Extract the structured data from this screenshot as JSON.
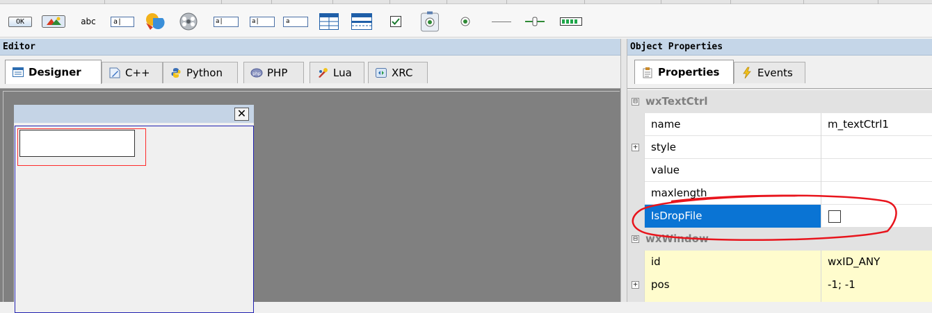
{
  "toolbar": {
    "items": [
      {
        "icon": "button-icon",
        "text": "OK"
      },
      {
        "icon": "bitmap-button-icon"
      },
      {
        "icon": "static-text-icon",
        "text": "abc"
      },
      {
        "icon": "text-ctrl-icon",
        "text": "a|"
      },
      {
        "icon": "combo-box-icon"
      },
      {
        "icon": "choice-icon"
      },
      {
        "icon": "list-box-icon",
        "text": "a|"
      },
      {
        "icon": "spin-ctrl-icon",
        "text": "a|"
      },
      {
        "icon": "dropdown-icon",
        "text": "a"
      },
      {
        "icon": "list-ctrl-icon"
      },
      {
        "icon": "grid-icon"
      },
      {
        "icon": "checkbox-icon"
      },
      {
        "icon": "radio-box-icon"
      },
      {
        "icon": "radio-button-icon"
      },
      {
        "icon": "static-line-icon"
      },
      {
        "icon": "slider-icon"
      },
      {
        "icon": "gauge-icon"
      }
    ]
  },
  "editor": {
    "title": "Editor",
    "tabs": [
      {
        "label": "Designer",
        "icon": "designer-icon",
        "active": true
      },
      {
        "label": "C++",
        "icon": "cpp-icon"
      },
      {
        "label": "Python",
        "icon": "python-icon"
      },
      {
        "label": "PHP",
        "icon": "php-icon"
      },
      {
        "label": "Lua",
        "icon": "lua-icon"
      },
      {
        "label": "XRC",
        "icon": "xrc-icon"
      }
    ],
    "frame_close_glyph": "✕"
  },
  "properties": {
    "title": "Object Properties",
    "tabs": [
      {
        "label": "Properties",
        "icon": "properties-icon",
        "active": true
      },
      {
        "label": "Events",
        "icon": "events-icon"
      }
    ],
    "rows": [
      {
        "type": "category",
        "name": "wxTextCtrl",
        "expander": "⊟"
      },
      {
        "type": "prop",
        "name": "name",
        "value": "m_textCtrl1"
      },
      {
        "type": "prop",
        "name": "style",
        "value": "",
        "expander": "+"
      },
      {
        "type": "prop",
        "name": "value",
        "value": ""
      },
      {
        "type": "prop",
        "name": "maxlength",
        "value": ""
      },
      {
        "type": "prop",
        "name": "IsDropFile",
        "value": "",
        "selected": true,
        "checkbox": true,
        "checked": false
      },
      {
        "type": "category",
        "name": "wxWindow",
        "expander": "⊟"
      },
      {
        "type": "prop",
        "name": "id",
        "value": "wxID_ANY",
        "highlight": true
      },
      {
        "type": "prop",
        "name": "pos",
        "value": "-1; -1",
        "expander": "+",
        "highlight": true
      }
    ]
  },
  "colors": {
    "panel_title_bg": "#c5d6e8",
    "selection_blue": "#0a74d4",
    "annotation_red": "#e8141c",
    "modified_yellow": "#fffccd",
    "canvas_gray": "#808080"
  }
}
